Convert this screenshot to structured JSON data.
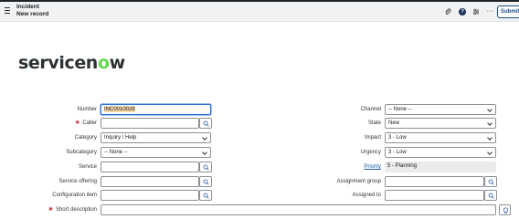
{
  "header": {
    "title": "Incident",
    "subtitle": "New record",
    "submit_label": "Submit",
    "icons": [
      "menu-icon",
      "paperclip-icon",
      "help-icon",
      "settings-sliders-icon",
      "more-options-icon"
    ]
  },
  "logo": {
    "text_main": "servicen",
    "text_accent": "o",
    "text_end": "w"
  },
  "left": {
    "number_label": "Number",
    "number_value": "INC0010028",
    "caller_label": "Caller",
    "caller_value": "",
    "category_label": "Category",
    "category_value": "Inquiry / Help",
    "subcategory_label": "Subcategory",
    "subcategory_value": "-- None --",
    "service_label": "Service",
    "service_value": "",
    "service_offering_label": "Service offering",
    "service_offering_value": "",
    "configuration_item_label": "Configuration item",
    "configuration_item_value": "",
    "short_description_label": "Short description",
    "short_description_value": ""
  },
  "right": {
    "channel_label": "Channel",
    "channel_value": "-- None --",
    "state_label": "State",
    "state_value": "New",
    "impact_label": "Impact",
    "impact_value": "3 - Low",
    "urgency_label": "Urgency",
    "urgency_value": "3 - Low",
    "priority_label": "Priority",
    "priority_value": "5 - Planning",
    "assignment_group_label": "Assignment group",
    "assignment_group_value": "",
    "assigned_to_label": "Assigned to",
    "assigned_to_value": ""
  },
  "colors": {
    "required": "#c83c3c",
    "brand_green": "#62d84e",
    "link": "#1a5fa8",
    "focus": "#2b6fd1"
  }
}
